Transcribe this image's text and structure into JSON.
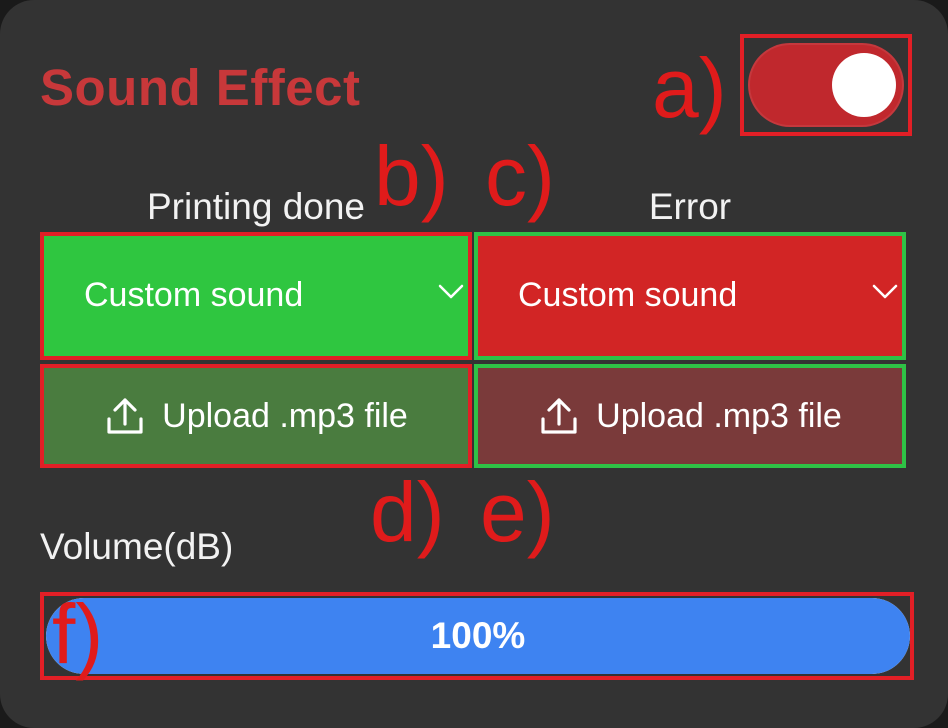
{
  "panel": {
    "title": "Sound Effect"
  },
  "toggle": {
    "state": "on",
    "accent": "#c0282d"
  },
  "columns": [
    {
      "label": "Printing done",
      "select_value": "Custom sound",
      "select_color": "#2fc640",
      "upload_label": "Upload .mp3 file",
      "upload_color": "#4a7c3f"
    },
    {
      "label": "Error",
      "select_value": "Custom sound",
      "select_color": "#d22525",
      "upload_label": "Upload .mp3 file",
      "upload_color": "#7a3a3a"
    }
  ],
  "volume": {
    "label": "Volume(dB)",
    "value_text": "100%",
    "value": 1.0,
    "fill_color": "#3e83f1"
  },
  "annotations": {
    "a": "a)",
    "b": "b)",
    "c": "c)",
    "d": "d)",
    "e": "e)",
    "f": "f)"
  },
  "icons": {
    "chevron": "chevron-down-icon",
    "upload": "upload-icon"
  }
}
